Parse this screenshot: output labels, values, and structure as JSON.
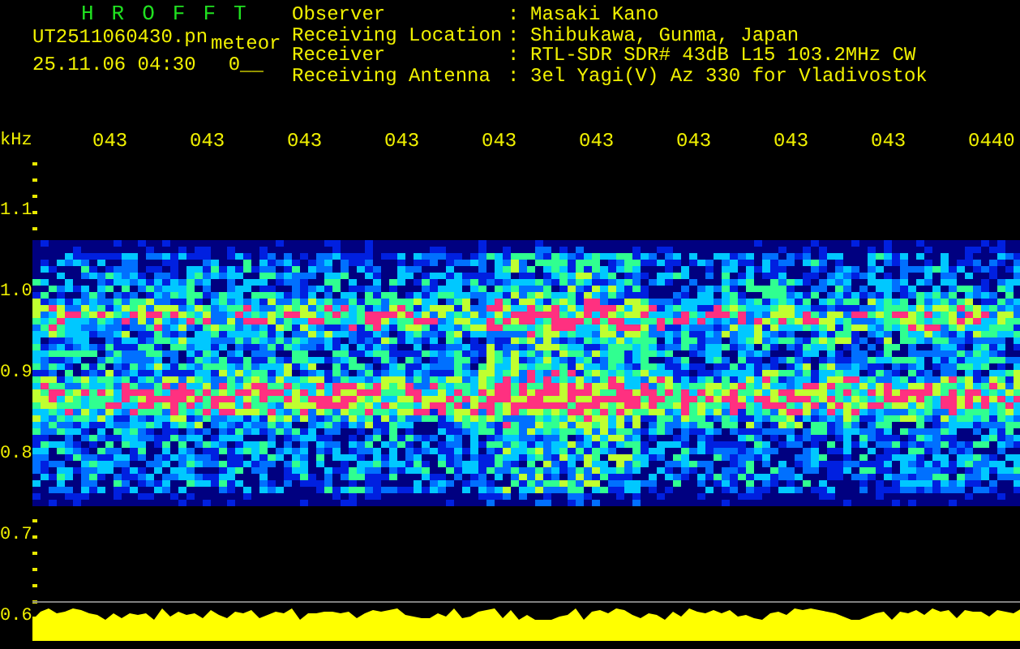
{
  "header": {
    "app_title": "HROFFT",
    "file_name": "UT2511060430.pn",
    "tag": "meteor",
    "timestamp": "25.11.06 04:30",
    "counter": "0__"
  },
  "station_info": [
    {
      "label": "Observer",
      "value": "Masaki Kano"
    },
    {
      "label": "Receiving Location",
      "value": "Shibukawa, Gunma, Japan"
    },
    {
      "label": "Receiver",
      "value": "RTL-SDR SDR# 43dB L15 103.2MHz CW"
    },
    {
      "label": "Receiving Antenna",
      "value": "3el Yagi(V) Az 330 for Vladivostok"
    }
  ],
  "separator": ":",
  "y_unit": "kHz",
  "time_labels": [
    "043",
    "043",
    "043",
    "043",
    "043",
    "043",
    "043",
    "043",
    "043",
    "0440"
  ],
  "y_labels": [
    "1.1",
    "1.0",
    "0.9",
    "0.8",
    "0.7",
    "0.6"
  ]
}
